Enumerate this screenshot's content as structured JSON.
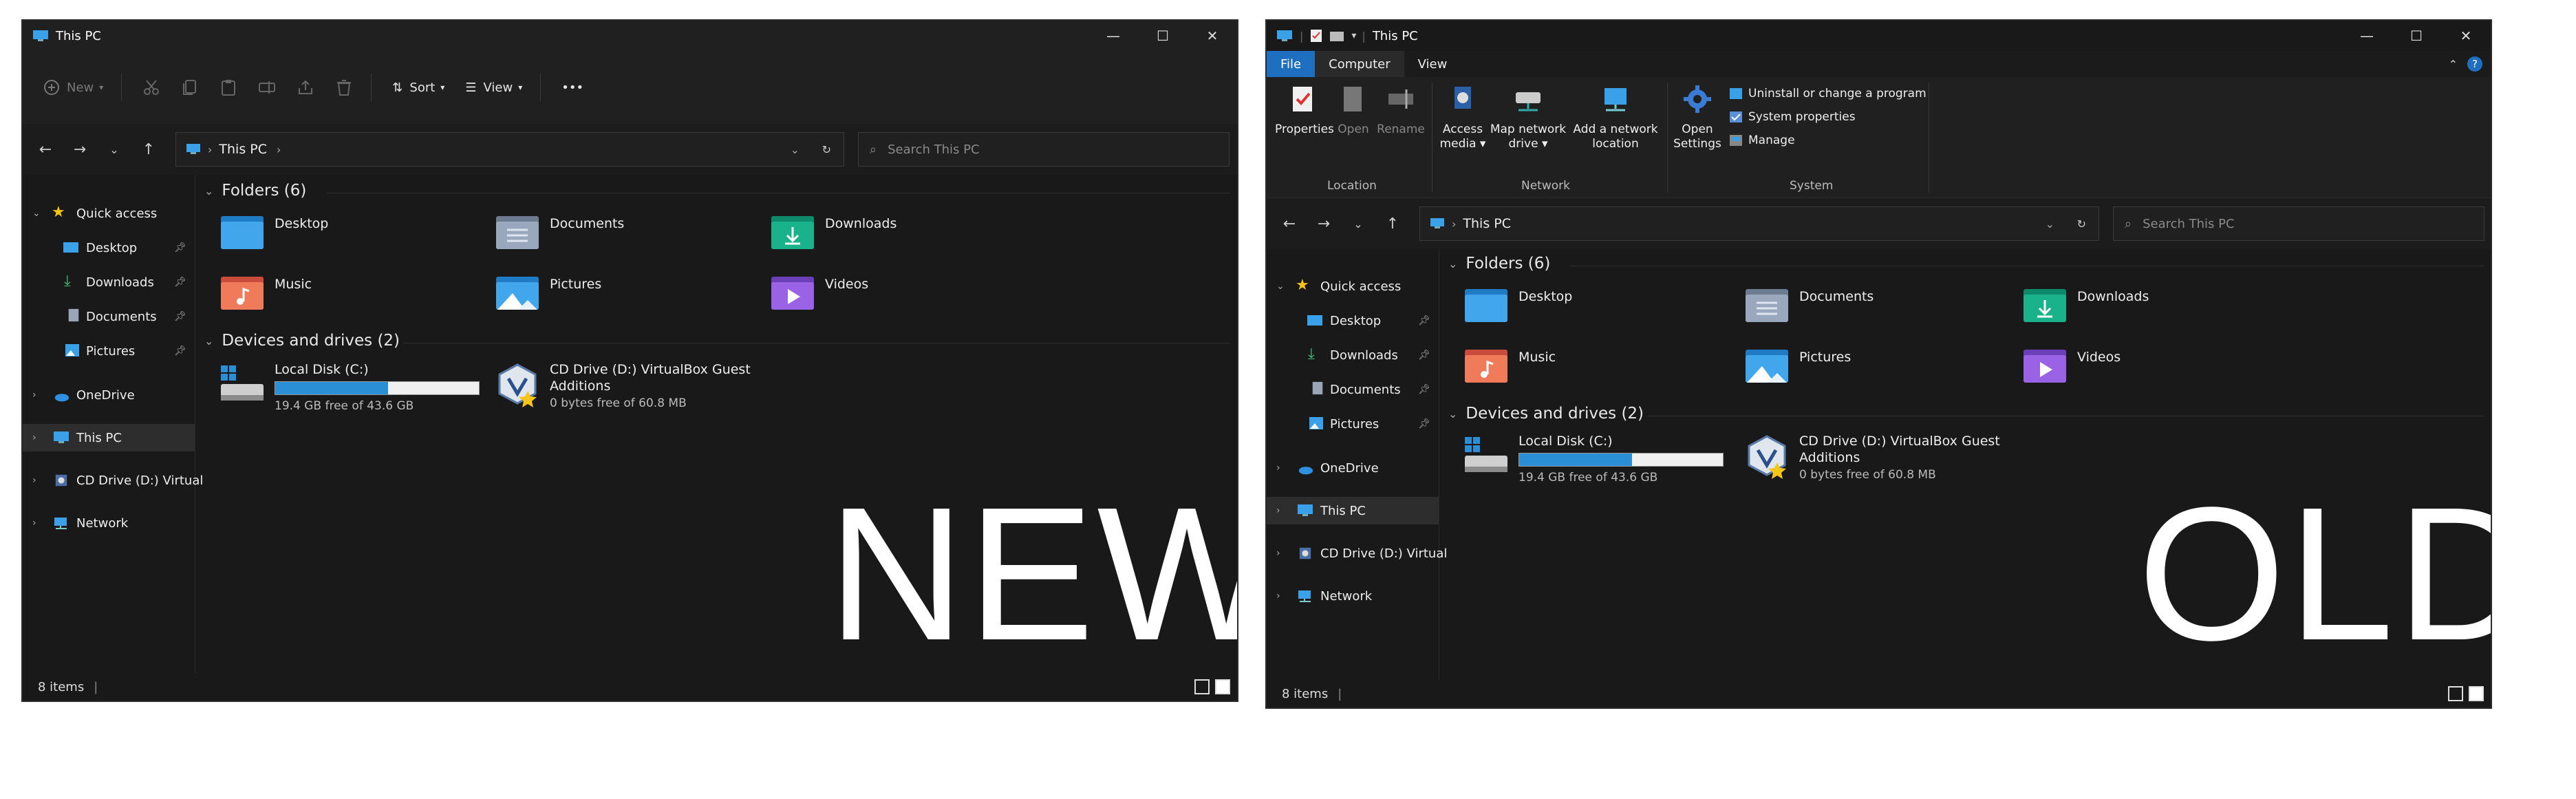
{
  "new": {
    "title": "This PC",
    "window_controls": {
      "minimize": "—",
      "maximize": "☐",
      "close": "✕"
    },
    "toolbar": {
      "new_label": "New",
      "sort_label": "Sort",
      "view_label": "View",
      "more_label": "•••"
    },
    "address": {
      "crumb": "This PC",
      "search_placeholder": "Search This PC"
    },
    "nav": {
      "quick_access": "Quick access",
      "items": [
        "Desktop",
        "Downloads",
        "Documents",
        "Pictures"
      ],
      "onedrive": "OneDrive",
      "this_pc": "This PC",
      "cd_drive": "CD Drive (D:) Virtual",
      "network": "Network"
    },
    "folders_header": "Folders (6)",
    "folders": [
      "Desktop",
      "Documents",
      "Downloads",
      "Music",
      "Pictures",
      "Videos"
    ],
    "devices_header": "Devices and drives (2)",
    "drives": {
      "c_name": "Local Disk (C:)",
      "c_free": "19.4 GB free of 43.6 GB",
      "c_used_fraction": 0.555,
      "d_name_1": "CD Drive (D:) VirtualBox Guest",
      "d_name_2": "Additions",
      "d_free": "0 bytes free of 60.8 MB"
    },
    "status": "8 items",
    "overlay": "NEW"
  },
  "old": {
    "title": "This PC",
    "window_controls": {
      "minimize": "—",
      "maximize": "☐",
      "close": "✕"
    },
    "tabs": {
      "file": "File",
      "computer": "Computer",
      "view": "View"
    },
    "ribbon": {
      "properties": "Properties",
      "open": "Open",
      "rename": "Rename",
      "access_media_1": "Access",
      "access_media_2": "media ▾",
      "map_network_1": "Map network",
      "map_network_2": "drive ▾",
      "add_network_1": "Add a network",
      "add_network_2": "location",
      "open_settings_1": "Open",
      "open_settings_2": "Settings",
      "uninstall": "Uninstall or change a program",
      "system_properties": "System properties",
      "manage": "Manage",
      "group_location": "Location",
      "group_network": "Network",
      "group_system": "System"
    },
    "address": {
      "crumb": "This PC",
      "search_placeholder": "Search This PC"
    },
    "nav": {
      "quick_access": "Quick access",
      "items": [
        "Desktop",
        "Downloads",
        "Documents",
        "Pictures"
      ],
      "onedrive": "OneDrive",
      "this_pc": "This PC",
      "cd_drive": "CD Drive (D:) Virtual",
      "network": "Network"
    },
    "folders_header": "Folders (6)",
    "folders": [
      "Desktop",
      "Documents",
      "Downloads",
      "Music",
      "Pictures",
      "Videos"
    ],
    "devices_header": "Devices and drives (2)",
    "drives": {
      "c_name": "Local Disk (C:)",
      "c_free": "19.4 GB free of 43.6 GB",
      "c_used_fraction": 0.555,
      "d_name_1": "CD Drive (D:) VirtualBox Guest",
      "d_name_2": "Additions",
      "d_free": "0 bytes free of 60.8 MB"
    },
    "status": "8 items",
    "overlay": "OLD"
  },
  "colors": {
    "accent": "#2b8fd6",
    "file_tab": "#1f6fc1",
    "window_bg": "#191919"
  }
}
